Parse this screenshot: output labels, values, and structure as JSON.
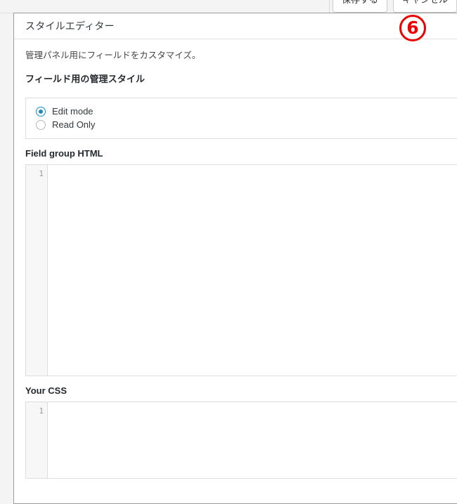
{
  "window": {
    "background_color": "#f4f4f4"
  },
  "top_toolbar": {
    "buttons": [
      {
        "name": "save-button",
        "label": "保存する"
      },
      {
        "name": "cancel-button",
        "label": "キャンセル"
      }
    ]
  },
  "panel": {
    "title": "スタイルエディター",
    "description": "管理パネル用にフィールドをカスタマイズ。",
    "section_heading": "フィールド用の管理スタイル",
    "border_color": "#9a9a9a",
    "background_color": "#ffffff"
  },
  "mode_radio_group": {
    "name": "style-mode",
    "selected": "Edit mode",
    "accent_color": "#1e8cbe",
    "options": [
      {
        "label": "Edit mode",
        "checked": true
      },
      {
        "label": "Read Only",
        "checked": false
      }
    ]
  },
  "code_fields": [
    {
      "label": "Field group HTML",
      "value": "",
      "placeholder": "",
      "line_numbers": [
        "1"
      ]
    },
    {
      "label": "Your CSS",
      "value": "",
      "placeholder": "",
      "line_numbers": [
        "1"
      ]
    }
  ],
  "annotation": {
    "label": "⑥",
    "color": "#ee0000"
  }
}
